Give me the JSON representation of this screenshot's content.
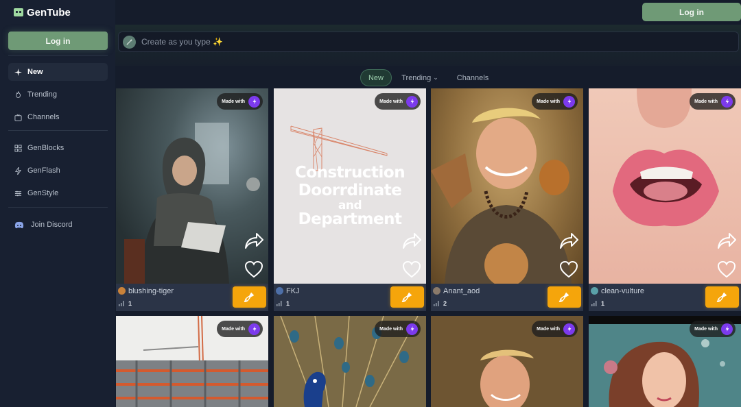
{
  "app": {
    "name": "GenTube"
  },
  "header": {
    "login_label": "Log in"
  },
  "sidebar": {
    "login_label": "Log in",
    "nav": [
      {
        "label": "New",
        "icon": "sparkles-icon"
      },
      {
        "label": "Trending",
        "icon": "flame-icon"
      },
      {
        "label": "Channels",
        "icon": "tv-icon"
      }
    ],
    "tools": [
      {
        "label": "GenBlocks",
        "icon": "blocks-icon"
      },
      {
        "label": "GenFlash",
        "icon": "flash-icon"
      },
      {
        "label": "GenStyle",
        "icon": "sliders-icon"
      }
    ],
    "discord_label": "Join Discord"
  },
  "search": {
    "placeholder": "Create as you type ✨"
  },
  "tabs": [
    {
      "label": "New"
    },
    {
      "label": "Trending"
    },
    {
      "label": "Channels"
    }
  ],
  "made_with_label": "Made with",
  "cards": [
    {
      "author": "blushing-tiger",
      "count": "1"
    },
    {
      "author": "FKJ",
      "count": "1",
      "image_text": [
        "Construction",
        "Doorrdinate",
        "and",
        "Department"
      ]
    },
    {
      "author": "Anant_aod",
      "count": "2"
    },
    {
      "author": "clean-vulture",
      "count": "1"
    },
    {},
    {},
    {},
    {}
  ],
  "colors": {
    "accent_green": "#6f9a76",
    "remix_orange": "#f5a50b",
    "badge_purple": "#7c3aed"
  }
}
